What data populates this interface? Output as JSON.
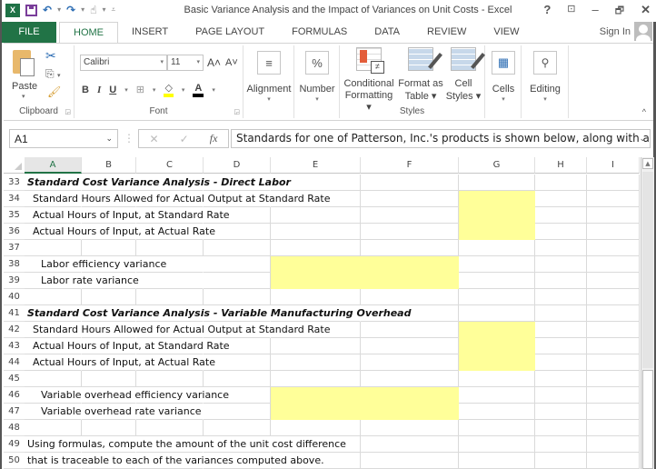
{
  "window": {
    "title": "Basic Variance Analysis and the Impact of Variances on Unit Costs - Excel",
    "controls": {
      "help": "?",
      "ribbon_display": "⊡",
      "minimize": "–",
      "restore": "🗗",
      "close": "✕"
    }
  },
  "qat": {
    "app_icon": "X≣",
    "undo": "↶",
    "redo": "↷",
    "touch": "☝",
    "more": "▾",
    "customize": "⩡"
  },
  "tabs": [
    {
      "label": "FILE",
      "active": false
    },
    {
      "label": "HOME",
      "active": true
    },
    {
      "label": "INSERT",
      "active": false
    },
    {
      "label": "PAGE LAYOUT",
      "active": false
    },
    {
      "label": "FORMULAS",
      "active": false
    },
    {
      "label": "DATA",
      "active": false
    },
    {
      "label": "REVIEW",
      "active": false
    },
    {
      "label": "VIEW",
      "active": false
    }
  ],
  "account": {
    "sign_in": "Sign In"
  },
  "ribbon": {
    "clipboard": {
      "paste": "Paste",
      "group": "Clipboard"
    },
    "font": {
      "font_name": "Calibri",
      "font_size": "11",
      "grow": "A˄",
      "shrink": "A˅",
      "bold": "B",
      "italic": "I",
      "underline": "U",
      "borders": "⊞",
      "fill_icon": "◇",
      "font_color": "A",
      "group": "Font",
      "fill_color": "#ffff00",
      "font_color_value": "#000000"
    },
    "alignment": {
      "label": "Alignment",
      "icon": "≡"
    },
    "number": {
      "label": "Number",
      "icon": "%"
    },
    "styles": {
      "conditional_formatting": [
        "Conditional",
        "Formatting ▾"
      ],
      "format_as_table": [
        "Format as",
        "Table ▾"
      ],
      "cell_styles": [
        "Cell",
        "Styles ▾"
      ],
      "group": "Styles"
    },
    "cells": {
      "label": "Cells",
      "icon": "▦"
    },
    "editing": {
      "label": "Editing",
      "icon": "🔭"
    },
    "collapse": "^"
  },
  "formula_bar": {
    "name_box": "A1",
    "cancel": "✕",
    "enter": "✓",
    "fx": "fx",
    "content": "Standards for one of Patterson, Inc.'s products is shown below, along with actual"
  },
  "sheet": {
    "columns": [
      "A",
      "B",
      "C",
      "D",
      "E",
      "F",
      "G",
      "H",
      "I"
    ],
    "selected_column": "A",
    "highlight_color": "#ffff99",
    "rows": [
      {
        "num": "33",
        "text": "Standard Cost Variance Analysis - Direct Labor",
        "style": "bold-italic",
        "indent": 0
      },
      {
        "num": "34",
        "text": "Standard Hours Allowed for Actual Output at Standard Rate",
        "style": "normal",
        "indent": 1
      },
      {
        "num": "35",
        "text": "Actual Hours of Input, at Standard Rate",
        "style": "normal",
        "indent": 1
      },
      {
        "num": "36",
        "text": "Actual Hours of Input, at Actual Rate",
        "style": "normal",
        "indent": 1
      },
      {
        "num": "37",
        "text": "",
        "style": "normal",
        "indent": 0
      },
      {
        "num": "38",
        "text": "Labor efficiency variance",
        "style": "normal",
        "indent": 2
      },
      {
        "num": "39",
        "text": "Labor rate variance",
        "style": "normal",
        "indent": 2
      },
      {
        "num": "40",
        "text": "",
        "style": "normal",
        "indent": 0
      },
      {
        "num": "41",
        "text": "Standard Cost Variance Analysis - Variable Manufacturing Overhead",
        "style": "bold-italic",
        "indent": 0
      },
      {
        "num": "42",
        "text": "Standard Hours Allowed for Actual Output at Standard Rate",
        "style": "normal",
        "indent": 1
      },
      {
        "num": "43",
        "text": "Actual Hours of Input, at Standard Rate",
        "style": "normal",
        "indent": 1
      },
      {
        "num": "44",
        "text": "Actual Hours of Input, at Actual Rate",
        "style": "normal",
        "indent": 1
      },
      {
        "num": "45",
        "text": "",
        "style": "normal",
        "indent": 0
      },
      {
        "num": "46",
        "text": "Variable overhead efficiency variance",
        "style": "normal",
        "indent": 2
      },
      {
        "num": "47",
        "text": "Variable overhead rate variance",
        "style": "normal",
        "indent": 2
      },
      {
        "num": "48",
        "text": "",
        "style": "normal",
        "indent": 0
      },
      {
        "num": "49",
        "text": "Using formulas, compute the amount of the unit cost difference",
        "style": "normal",
        "indent": 0
      },
      {
        "num": "50",
        "text": "that is traceable to each of the variances computed above.",
        "style": "normal",
        "indent": 0
      }
    ],
    "input_cells": {
      "G": [
        "34",
        "35",
        "36",
        "42",
        "43",
        "44"
      ],
      "E:F": [
        "38",
        "39",
        "46",
        "47"
      ]
    }
  }
}
